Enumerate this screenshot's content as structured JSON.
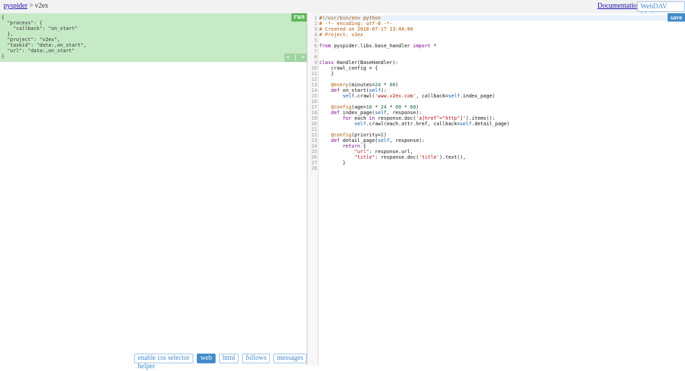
{
  "header": {
    "breadcrumb_root": "pyspider",
    "breadcrumb_sep": ">",
    "breadcrumb_project": "v2ex",
    "documentation": "Documentation",
    "webdav": "WebDAV Mode"
  },
  "task_panel": {
    "run_label": "run",
    "prev_label": "<",
    "sep_label": "|",
    "next_label": ">",
    "json_lines": [
      "{",
      "  \"process\": {",
      "    \"callback\": \"on_start\"",
      "  },",
      "  \"project\": \"v2ex\",",
      "  \"taskid\": \"data:,on_start\",",
      "  \"url\": \"data:,on_start\"",
      "}"
    ]
  },
  "bottom_tabs": [
    {
      "label": "enable css selector helper",
      "active": false
    },
    {
      "label": "web",
      "active": true
    },
    {
      "label": "html",
      "active": false
    },
    {
      "label": "follows",
      "active": false
    },
    {
      "label": "messages",
      "active": false
    }
  ],
  "editor": {
    "save_label": "save",
    "line_count": 28,
    "code_lines": [
      "#!/usr/bin/env python",
      "# -*- encoding: utf-8 -*-",
      "# Created on 2018-07-17 13:44:00",
      "# Project: v2ex",
      "",
      "from pyspider.libs.base_handler import *",
      "",
      "",
      "class Handler(BaseHandler):",
      "    crawl_config = {",
      "    }",
      "",
      "    @every(minutes=24 * 60)",
      "    def on_start(self):",
      "        self.crawl('www.v2ex.com', callback=self.index_page)",
      "",
      "    @config(age=10 * 24 * 60 * 60)",
      "    def index_page(self, response):",
      "        for each in response.doc('a[href^=\"http\"]').items():",
      "            self.crawl(each.attr.href, callback=self.detail_page)",
      "",
      "    @config(priority=2)",
      "    def detail_page(self, response):",
      "        return {",
      "            \"url\": response.url,",
      "            \"title\": response.doc('title').text(),",
      "        }",
      ""
    ]
  }
}
